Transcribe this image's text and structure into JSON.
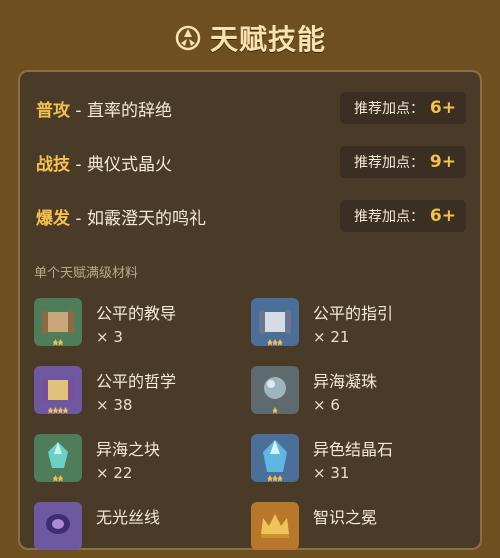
{
  "header": {
    "title": "天赋技能",
    "icon": "talent-symbol-icon"
  },
  "skills": [
    {
      "kind": "普攻",
      "sep": " - ",
      "name": "直率的辞绝",
      "rec_label": "推荐加点：",
      "rec_value": "6+"
    },
    {
      "kind": "战技",
      "sep": " - ",
      "name": "典仪式晶火",
      "rec_label": "推荐加点：",
      "rec_value": "9+"
    },
    {
      "kind": "爆发",
      "sep": " - ",
      "name": "如霰澄天的鸣礼",
      "rec_label": "推荐加点：",
      "rec_value": "6+"
    }
  ],
  "materials": {
    "section_title": "单个天赋满级材料",
    "items": [
      {
        "name": "公平的教导",
        "count": "× 3",
        "icon": "scroll-green-icon",
        "stars": 2,
        "color": "#4f7d5a"
      },
      {
        "name": "公平的指引",
        "count": "× 21",
        "icon": "scroll-blue-icon",
        "stars": 3,
        "color": "#4c6f9a"
      },
      {
        "name": "公平的哲学",
        "count": "× 38",
        "icon": "scroll-purple-icon",
        "stars": 4,
        "color": "#6e58a0"
      },
      {
        "name": "异海凝珠",
        "count": "× 6",
        "icon": "pearl-icon",
        "stars": 1,
        "color": "#5f6a6e"
      },
      {
        "name": "异海之块",
        "count": "× 22",
        "icon": "crystal-chunk-icon",
        "stars": 2,
        "color": "#4f7d5a"
      },
      {
        "name": "异色结晶石",
        "count": "× 31",
        "icon": "crystal-gem-icon",
        "stars": 3,
        "color": "#4c6f9a"
      },
      {
        "name": "无光丝线",
        "count": "",
        "icon": "silk-thread-icon",
        "stars": 0,
        "color": "#6e58a0"
      },
      {
        "name": "智识之冕",
        "count": "",
        "icon": "crown-icon",
        "stars": 0,
        "color": "#b9772c"
      }
    ]
  },
  "colors": {
    "background": "#6e4f20",
    "panel": "#4a3b28",
    "accent": "#f4c14e"
  }
}
